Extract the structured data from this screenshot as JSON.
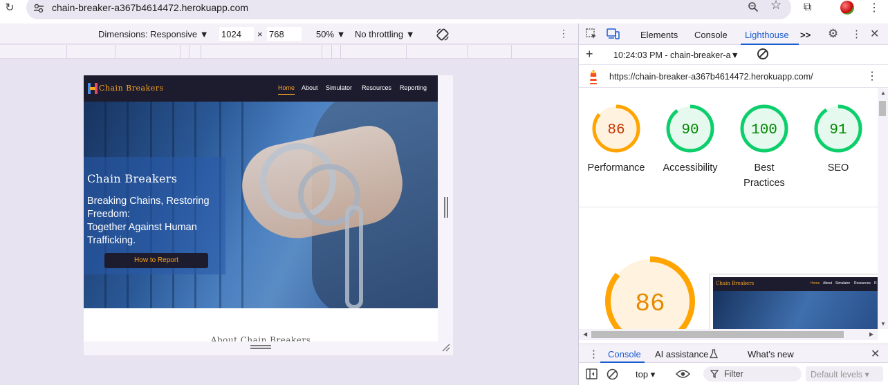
{
  "browser": {
    "url": "chain-breaker-a367b4614472.herokuapp.com"
  },
  "device_toolbar": {
    "dimensions_label": "Dimensions: Responsive",
    "width_value": "1024",
    "times_sign": "×",
    "height_value": "768",
    "zoom_label": "50%",
    "throttling_label": "No throttling"
  },
  "site": {
    "logo_text": "Chain Breakers",
    "nav": [
      "Home",
      "About",
      "Simulator",
      "Resources",
      "Reporting"
    ],
    "hero_title": "Chain Breakers",
    "tagline_lines": [
      "Breaking Chains, Restoring",
      "Freedom:",
      "Together Against Human",
      "Trafficking."
    ],
    "hero_button": "How to Report",
    "about_heading": "About Chain Breakers"
  },
  "devtools": {
    "tabs": [
      "Elements",
      "Console",
      "Lighthouse"
    ],
    "active_tab": "Lighthouse",
    "more_tabs": ">>",
    "lighthouse": {
      "session_label": "10:24:03 PM - chain-breaker-a",
      "report_url": "https://chain-breaker-a367b4614472.herokuapp.com/",
      "scores": [
        {
          "value": "86",
          "label_lines": [
            "Performance"
          ],
          "color": "#ffa400",
          "bg": "#fff3e0",
          "text_color": "#c33300"
        },
        {
          "value": "90",
          "label_lines": [
            "Accessibility"
          ],
          "color": "#0cce6b",
          "bg": "#e6f9ee",
          "text_color": "#008800"
        },
        {
          "value": "100",
          "label_lines": [
            "Best",
            "Practices"
          ],
          "color": "#0cce6b",
          "bg": "#e6f9ee",
          "text_color": "#008800"
        },
        {
          "value": "91",
          "label_lines": [
            "SEO"
          ],
          "color": "#0cce6b",
          "bg": "#e6f9ee",
          "text_color": "#008800"
        }
      ],
      "big_score": "86",
      "thumb_logo": "Chain Breakers",
      "thumb_nav": [
        "Home",
        "About",
        "Simulator",
        "Resources",
        "R"
      ]
    },
    "drawer": {
      "tabs": [
        "Console",
        "AI assistance",
        "What's new"
      ],
      "context": "top",
      "filter_placeholder": "Filter",
      "levels": "Default levels"
    }
  },
  "colors": {
    "accent": "#1a5ccf",
    "site_orange": "#f5a623",
    "site_dark": "#1d1b2e"
  }
}
